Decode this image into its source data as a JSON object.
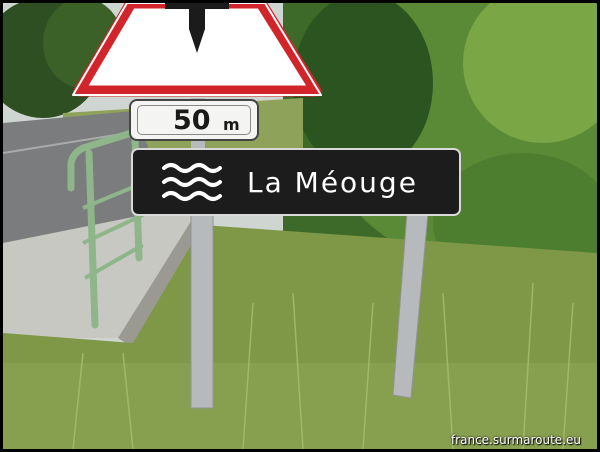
{
  "scene": {
    "description_colors": {
      "sky": "#d9dfe0",
      "foliage_dark": "#2f5a1f",
      "foliage_light": "#6f9a3a",
      "grass": "#8aa052",
      "road": "#7d7f80",
      "sidewalk": "#c9c9c4",
      "railing": "#8fb58a",
      "sign_black": "#1b1b1b",
      "sign_red": "#d2242b",
      "post": "#b9bcc0"
    }
  },
  "warning_sign": {
    "icon": "priority-road-intersection-icon"
  },
  "distance_plate": {
    "number": "50",
    "unit": "m"
  },
  "river_sign": {
    "icon": "water-waves-icon",
    "name": "La Méouge"
  },
  "watermark": {
    "text": "france.surmaroute.eu"
  }
}
